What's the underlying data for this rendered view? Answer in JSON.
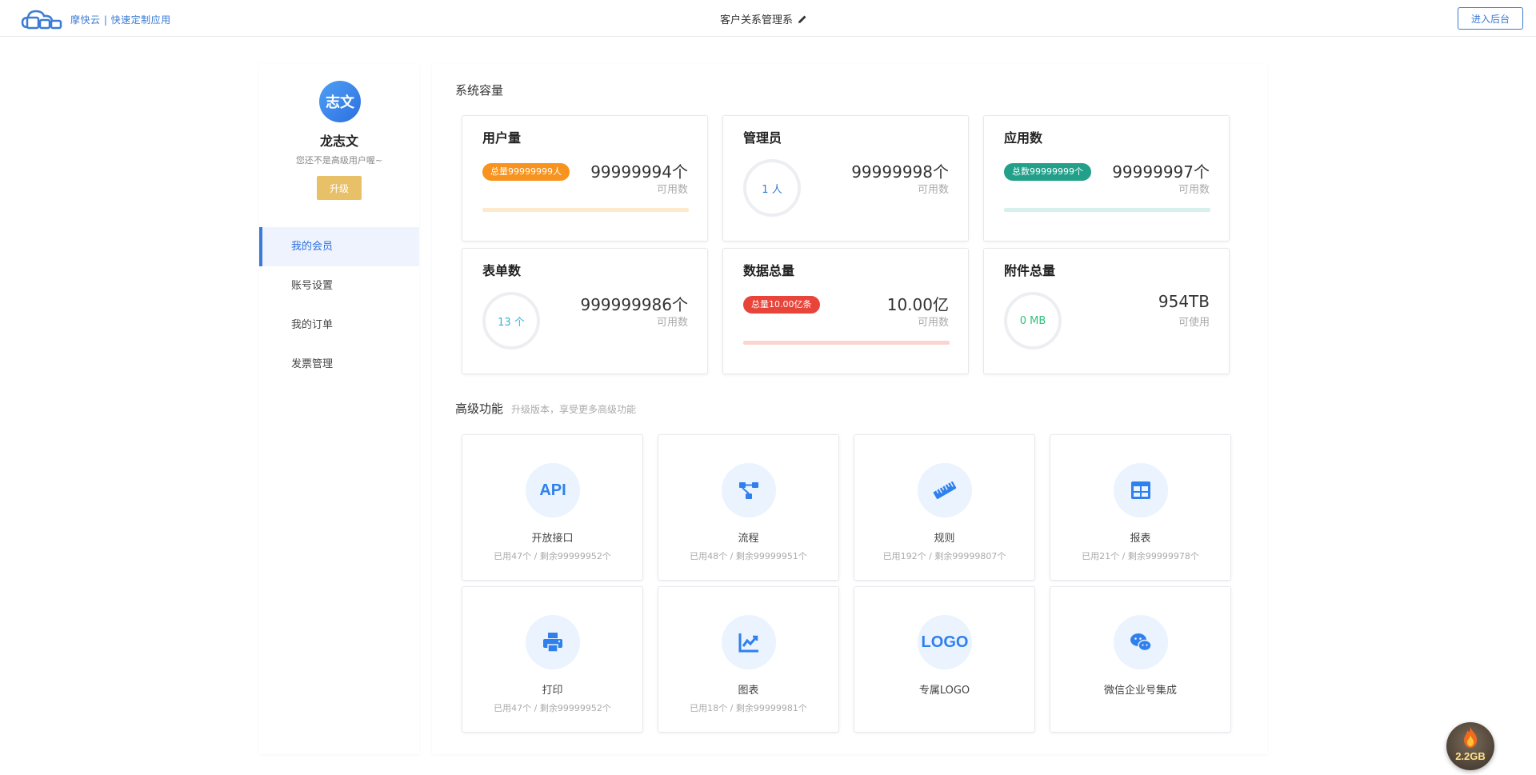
{
  "header": {
    "brand": "摩快云 | 快速定制应用",
    "app_title": "客户关系管理系",
    "enter_label": "进入后台"
  },
  "sidebar": {
    "avatar_text": "志文",
    "username": "龙志文",
    "hint": "您还不是高级用户喔~",
    "upgrade_label": "升级",
    "nav": [
      {
        "label": "我的会员",
        "active": true
      },
      {
        "label": "账号设置"
      },
      {
        "label": "我的订单"
      },
      {
        "label": "发票管理"
      }
    ]
  },
  "capacity": {
    "title": "系统容量",
    "cards": [
      {
        "label": "用户量",
        "badge": "总量99999999人",
        "value": "99999994个",
        "sub": "可用数",
        "color": "#f7931e",
        "bar_color": "#fde9cc",
        "used_fraction": 0.0
      },
      {
        "label": "管理员",
        "circle": "1 人",
        "value": "99999998个",
        "sub": "可用数",
        "color": "#3a7bd5"
      },
      {
        "label": "应用数",
        "badge": "总数99999999个",
        "value": "99999997个",
        "sub": "可用数",
        "color": "#22a08a",
        "bar_color": "#d6f0ec",
        "used_fraction": 0.0
      },
      {
        "label": "表单数",
        "circle": "13 个",
        "value": "999999986个",
        "sub": "可用数",
        "color": "#35b2d8"
      },
      {
        "label": "数据总量",
        "badge": "总量10.00亿条",
        "value": "10.00亿",
        "sub": "可用数",
        "color": "#e8443a",
        "bar_color": "#fbd4d0",
        "used_fraction": 0.0
      },
      {
        "label": "附件总量",
        "circle": "0 MB",
        "value": "954TB",
        "sub": "可使用",
        "color": "#2ec27e"
      }
    ]
  },
  "features": {
    "title": "高级功能",
    "subtitle": "升级版本，享受更多高级功能",
    "items": [
      {
        "icon": "api-icon",
        "icon_text": "API",
        "name": "开放接口",
        "usage": "已用47个 / 剩余99999952个"
      },
      {
        "icon": "workflow-icon",
        "name": "流程",
        "usage": "已用48个 / 剩余99999951个"
      },
      {
        "icon": "ruler-icon",
        "name": "规则",
        "usage": "已用192个 / 剩余99999807个"
      },
      {
        "icon": "table-icon",
        "name": "报表",
        "usage": "已用21个 / 剩余99999978个"
      },
      {
        "icon": "printer-icon",
        "name": "打印",
        "usage": "已用47个 / 剩余99999952个"
      },
      {
        "icon": "chart-icon",
        "name": "图表",
        "usage": "已用18个 / 剩余99999981个"
      },
      {
        "icon": "logo-icon",
        "icon_text": "LOGO",
        "name": "专属LOGO",
        "usage": ""
      },
      {
        "icon": "wechat-icon",
        "name": "微信企业号集成",
        "usage": ""
      }
    ]
  },
  "float_badge": {
    "label": "2.2GB"
  },
  "colors": {
    "accent": "#3a7bd5",
    "upgrade": "#e8c068",
    "icon_bg": "#eaf3fe"
  }
}
